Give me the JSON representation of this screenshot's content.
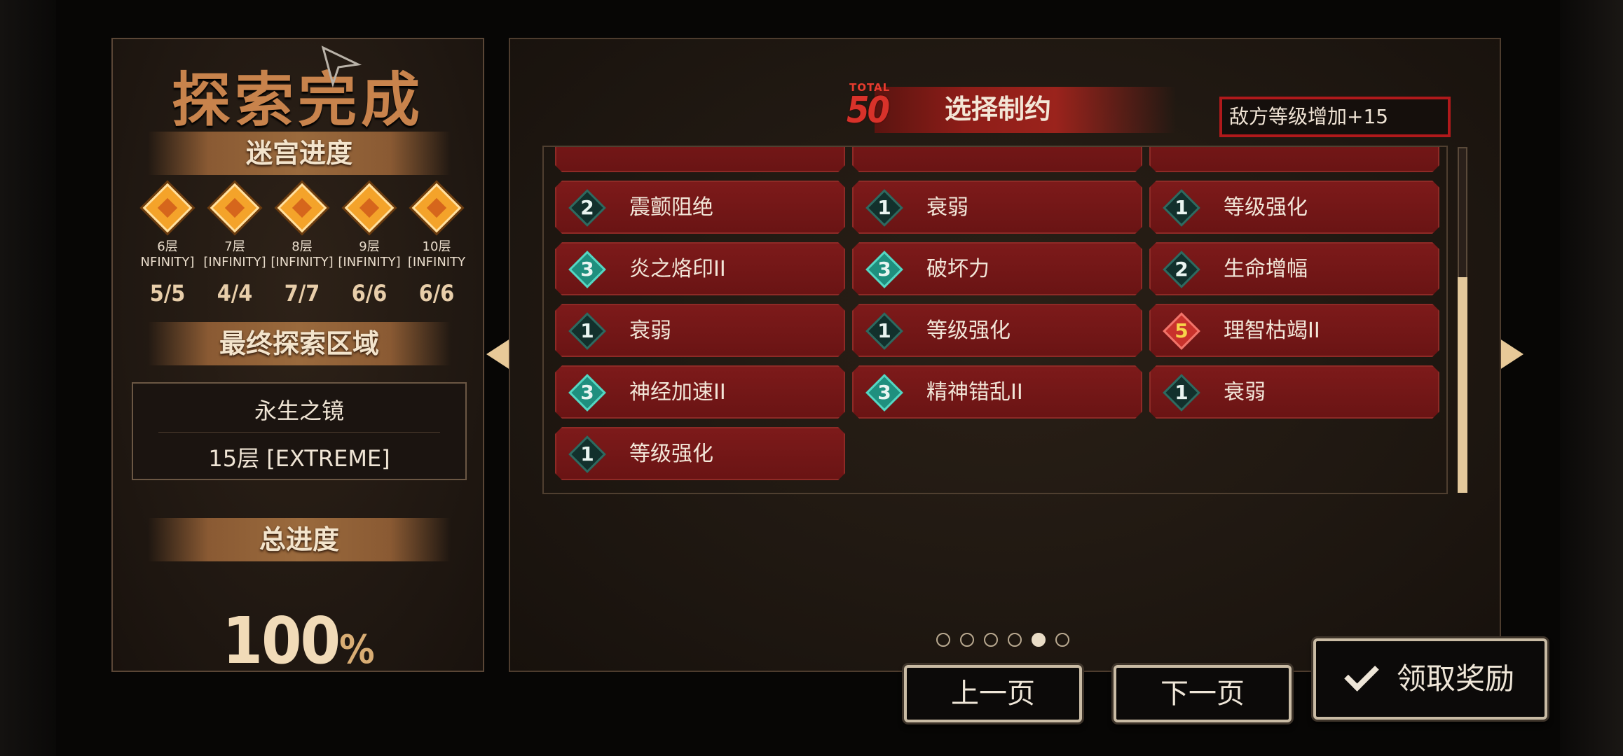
{
  "left": {
    "title": "探索完成",
    "maze_progress_label": "迷宫进度",
    "floors": [
      {
        "name": "6层",
        "mode": "NFINITY]",
        "count": "5/5"
      },
      {
        "name": "7层",
        "mode": "[INFINITY]",
        "count": "4/4"
      },
      {
        "name": "8层",
        "mode": "[INFINITY]",
        "count": "7/7"
      },
      {
        "name": "9层",
        "mode": "[INFINITY]",
        "count": "6/6"
      },
      {
        "name": "10层",
        "mode": "[INFINITY",
        "count": "6/6"
      }
    ],
    "final_area_label": "最终探索区域",
    "area_name": "永生之镜",
    "area_floor": "15层 [EXTREME]",
    "total_progress_label": "总进度",
    "total_progress_value": "100",
    "total_progress_unit": "%",
    "medal_color": "#f4a32a"
  },
  "right": {
    "total_badge_label": "TOTAL",
    "total_value": "50",
    "header_title": "选择制约",
    "status_text": "敌方等级增加+15",
    "cards": [
      {
        "level": "2",
        "label": "震颤阻绝",
        "tier": "lv2"
      },
      {
        "level": "1",
        "label": "衰弱",
        "tier": "lv1"
      },
      {
        "level": "1",
        "label": "等级强化",
        "tier": "lv1"
      },
      {
        "level": "3",
        "label": "炎之烙印II",
        "tier": "lv3"
      },
      {
        "level": "3",
        "label": "破坏力",
        "tier": "lv3"
      },
      {
        "level": "2",
        "label": "生命增幅",
        "tier": "lv2"
      },
      {
        "level": "1",
        "label": "衰弱",
        "tier": "lv1"
      },
      {
        "level": "1",
        "label": "等级强化",
        "tier": "lv1"
      },
      {
        "level": "5",
        "label": "理智枯竭II",
        "tier": "lv5"
      },
      {
        "level": "3",
        "label": "神经加速II",
        "tier": "lv3"
      },
      {
        "level": "3",
        "label": "精神错乱II",
        "tier": "lv3"
      },
      {
        "level": "1",
        "label": "衰弱",
        "tier": "lv1"
      },
      {
        "level": "1",
        "label": "等级强化",
        "tier": "lv1"
      }
    ],
    "page_count": 6,
    "current_page": 5,
    "accent_color": "#b0191b"
  },
  "buttons": {
    "prev": "上一页",
    "next": "下一页",
    "claim": "领取奖励"
  }
}
